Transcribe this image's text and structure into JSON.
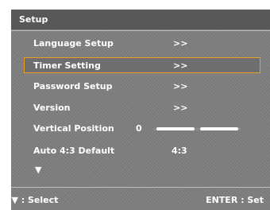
{
  "header": {
    "title": "Setup"
  },
  "menu": {
    "items": [
      {
        "label": "Language Setup",
        "value": ">>"
      },
      {
        "label": "Timer Setting",
        "value": ">>"
      },
      {
        "label": "Password Setup",
        "value": ">>"
      },
      {
        "label": "Version",
        "value": ">>"
      },
      {
        "label": "Vertical Position",
        "value": "0",
        "slider_level": 0.5
      },
      {
        "label": "Auto 4:3 Default",
        "value": "4:3"
      }
    ],
    "selected_index": 1,
    "more_indicator": "▼"
  },
  "footer": {
    "select_hint": "▲▼ : Select",
    "enter_hint": "ENTER : Set"
  },
  "colors": {
    "panel": "#7e7e7e",
    "title_bar": "#585858",
    "selection_border": "#e8a020"
  },
  "icons": {
    "more": "down-arrow-icon",
    "nav": "up-down-arrows-icon"
  }
}
